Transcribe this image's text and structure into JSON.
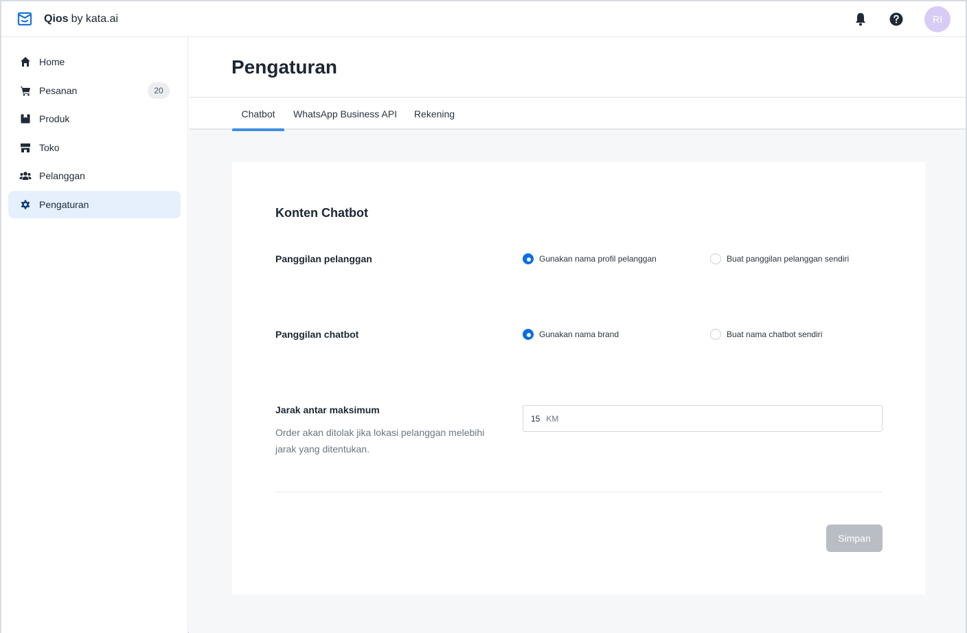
{
  "app": {
    "brand_name": "Qios",
    "brand_sub": "by kata.ai",
    "avatar_initials": "RI",
    "accent_color": "#0b6ee5"
  },
  "header": {
    "icons": [
      "bell-icon",
      "help-icon"
    ]
  },
  "sidebar": {
    "items": [
      {
        "label": "Home",
        "icon": "home-icon"
      },
      {
        "label": "Pesanan",
        "icon": "cart-icon",
        "badge": "20"
      },
      {
        "label": "Produk",
        "icon": "box-icon"
      },
      {
        "label": "Toko",
        "icon": "store-icon"
      },
      {
        "label": "Pelanggan",
        "icon": "users-icon"
      },
      {
        "label": "Pengaturan",
        "icon": "gear-icon",
        "active": true
      }
    ]
  },
  "page": {
    "title": "Pengaturan",
    "tabs": [
      {
        "label": "Chatbot",
        "active": true
      },
      {
        "label": "WhatsApp Business API"
      },
      {
        "label": "Rekening"
      }
    ]
  },
  "form": {
    "section_title": "Konten Chatbot",
    "customer_call": {
      "label": "Panggilan pelanggan",
      "options": [
        "Gunakan nama profil pelanggan",
        "Buat panggilan pelanggan sendiri"
      ],
      "selected": "Gunakan nama profil pelanggan"
    },
    "chatbot_call": {
      "label": "Panggilan chatbot",
      "options": [
        "Gunakan nama brand",
        "Buat nama chatbot sendiri"
      ],
      "selected": "Gunakan nama brand"
    },
    "max_distance": {
      "label": "Jarak antar maksimum",
      "help": "Order akan ditolak jika lokasi pelanggan melebihi jarak yang ditentukan.",
      "value": "15",
      "unit": "KM"
    },
    "save_label": "Simpan"
  }
}
